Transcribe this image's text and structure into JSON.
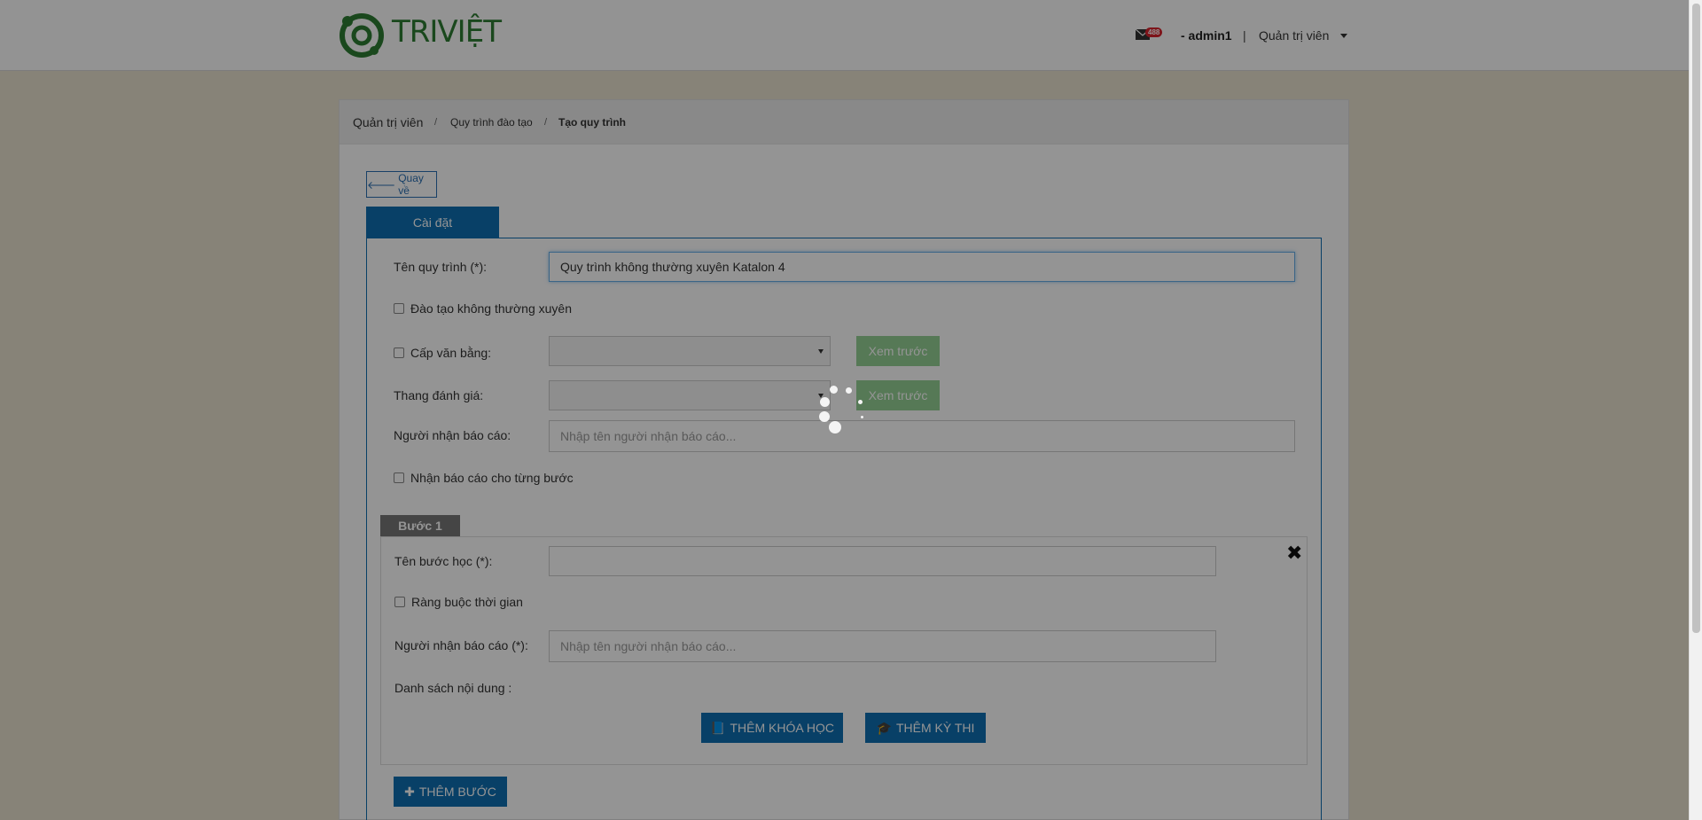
{
  "header": {
    "logo_text": "TRIVIỆT",
    "mail_count": "488",
    "user_name": "- admin1",
    "separator": "|",
    "role": "Quản trị viên"
  },
  "breadcrumb": {
    "items": [
      "Quản trị viên",
      "Quy trình đào tạo",
      "Tạo quy trình"
    ],
    "separator": "/"
  },
  "back_label": "Quay về",
  "tab_label": "Cài đặt",
  "form": {
    "name_label": "Tên quy trình (*):",
    "name_value": "Quy trình không thường xuyên Katalon 4",
    "irregular_label": "Đào tạo không thường xuyên",
    "certificate_label": "Cấp văn bằng:",
    "preview_label": "Xem trước",
    "rating_label": "Thang đánh giá:",
    "receiver_label": "Người nhận báo cáo:",
    "receiver_placeholder": "Nhập tên người nhận báo cáo...",
    "report_each_step_label": "Nhận báo cáo cho từng bước"
  },
  "step": {
    "tag": "Bước 1",
    "close": "✖",
    "name_label": "Tên bước học (*):",
    "name_value": "",
    "time_constraint_label": "Ràng buộc thời gian",
    "receiver_label": "Người nhận báo cáo (*):",
    "receiver_placeholder": "Nhập tên người nhận báo cáo...",
    "content_list_label": "Danh sách nội dung :",
    "add_course_label": "THÊM KHÓA HỌC",
    "add_exam_label": "THÊM KỲ THI"
  },
  "add_step_label": "THÊM BƯỚC",
  "colors": {
    "primary": "#0e6fb2",
    "success": "#5cb85c",
    "badge": "#d9232d",
    "logo": "#2e7d32"
  },
  "icons": [
    "envelope-icon",
    "caret-down-icon",
    "arrow-left-icon",
    "book-icon",
    "graduation-cap-icon",
    "plus-icon",
    "close-icon",
    "spinner-icon"
  ]
}
